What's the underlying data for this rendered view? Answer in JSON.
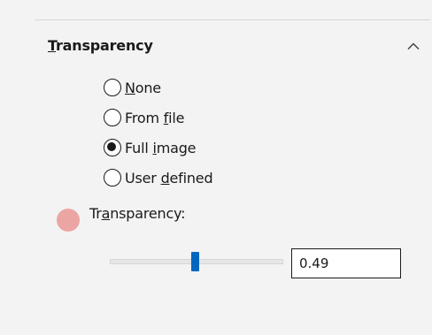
{
  "section": {
    "title_mnemonic": "T",
    "title_rest": "ransparency",
    "collapse_icon": "chevron-up-icon"
  },
  "radios": [
    {
      "pre": "",
      "mnemonic": "N",
      "post": "one",
      "checked": false
    },
    {
      "pre": "From ",
      "mnemonic": "f",
      "post": "ile",
      "checked": false
    },
    {
      "pre": "Full ",
      "mnemonic": "i",
      "post": "mage",
      "checked": true
    },
    {
      "pre": "User ",
      "mnemonic": "d",
      "post": "efined",
      "checked": false
    }
  ],
  "status_icon": {
    "name": "color-swatch-icon",
    "color": "#eba6a3"
  },
  "slider": {
    "label_pre": "Tr",
    "label_mnemonic": "a",
    "label_post": "nsparency:",
    "value": 0.49,
    "value_text": "0.49",
    "accent": "#0067c0"
  }
}
